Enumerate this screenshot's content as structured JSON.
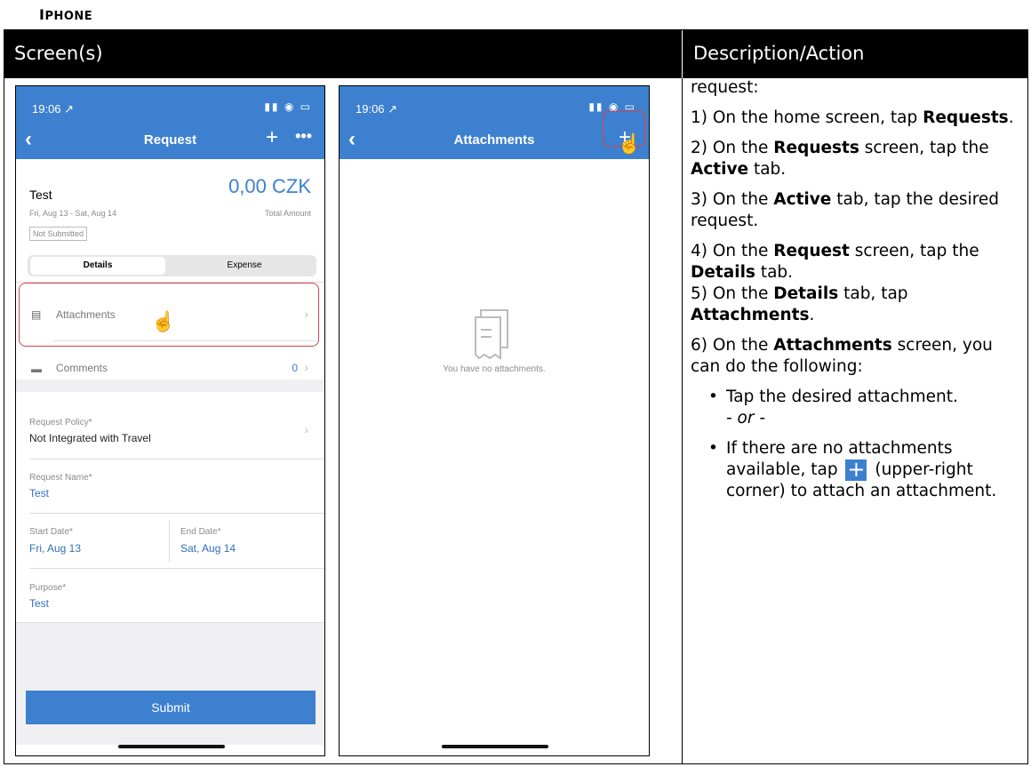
{
  "heading": {
    "first": "I",
    "rest": "PHONE"
  },
  "table": {
    "col_screens": "Screen(s)",
    "col_desc": "Description/Action"
  },
  "phone1": {
    "time": "19:06 ↗",
    "sys_icons": "▮▮ ◉ ▭",
    "back": "‹",
    "title": "Request",
    "plus": "+",
    "more": "•••",
    "name": "Test",
    "amount": "0,00 CZK",
    "dates": "Fri, Aug 13 - Sat, Aug 14",
    "total_label": "Total Amount",
    "status": "Not Submitted",
    "seg_details": "Details",
    "seg_expense": "Expense",
    "attachments": "Attachments",
    "comments": "Comments",
    "comments_count": "0",
    "chev": "›",
    "hand": "☝",
    "policy_label": "Request Policy*",
    "policy_value": "Not Integrated with Travel",
    "name_label": "Request Name*",
    "name_value": "Test",
    "start_label": "Start Date*",
    "start_value": "Fri, Aug 13",
    "end_label": "End Date*",
    "end_value": "Sat, Aug 14",
    "purpose_label": "Purpose*",
    "purpose_value": "Test",
    "submit": "Submit",
    "doc_icon": "▤",
    "chat_icon": "▬"
  },
  "phone2": {
    "time": "19:06 ↗",
    "sys_icons": "▮▮ ◉ ▭",
    "back": "‹",
    "title": "Attachments",
    "plus": "+",
    "hand": "☝",
    "empty": "You have no attachments."
  },
  "desc": {
    "intro": "To attach an attachment to a travel request:",
    "s1a": "1) On the home screen, tap ",
    "s1b": "Requests",
    "s1c": ".",
    "s2a": "2) On the ",
    "s2b": "Requests",
    "s2c": " screen, tap the ",
    "s2d": "Active",
    "s2e": " tab.",
    "s3a": "3) On the ",
    "s3b": "Active",
    "s3c": " tab, tap the desired request.",
    "s4a": "4) On the ",
    "s4b": "Request",
    "s4c": " screen, tap the ",
    "s4d": "Details",
    "s4e": " tab.",
    "s5a": "5) On the ",
    "s5b": "Details",
    "s5c": " tab, tap ",
    "s5d": "Attachments",
    "s5e": ".",
    "s6a": "6) On the ",
    "s6b": "Attachments",
    "s6c": " screen, you can do the following:",
    "b1": "Tap the desired attachment.",
    "or": "- or -",
    "b2a": "If there are no attachments available, tap ",
    "b2_icon": "+",
    "b2b": " (upper-right corner) to attach an attachment."
  },
  "colors": {
    "accent": "#3d80cf",
    "highlight": "#d8424a"
  }
}
